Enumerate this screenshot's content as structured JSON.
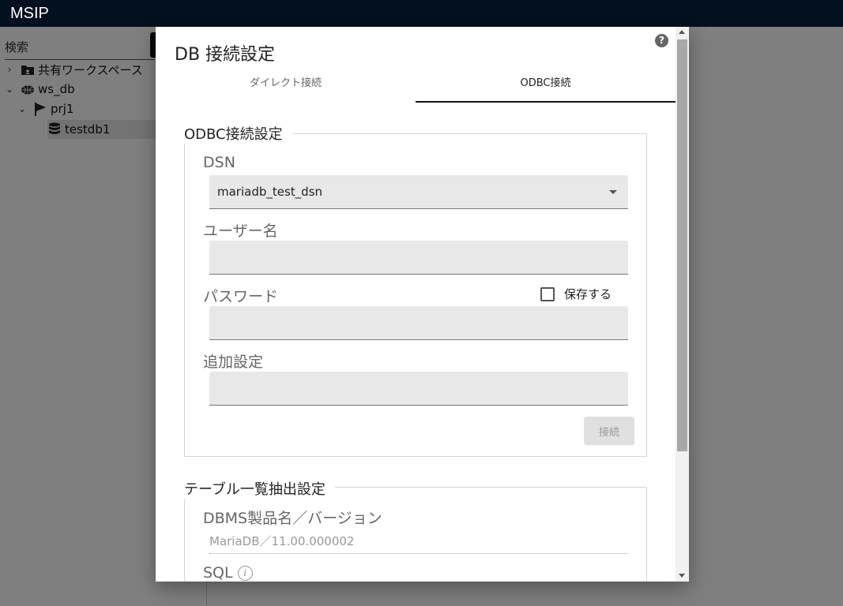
{
  "app": {
    "title": "MSIP"
  },
  "sidebar": {
    "search_placeholder": "検索",
    "tree": [
      {
        "label": "共有ワークスペース",
        "chevron": "›",
        "icon": "shared-folder-icon"
      },
      {
        "label": "ws_db",
        "chevron": "⌄",
        "icon": "globe-icon"
      },
      {
        "label": "prj1",
        "chevron": "⌄",
        "icon": "flag-icon"
      },
      {
        "label": "testdb1",
        "chevron": "",
        "icon": "database-icon"
      }
    ]
  },
  "dialog": {
    "title": "DB 接続設定",
    "help_icon": "?",
    "tabs": [
      {
        "label": "ダイレクト接続",
        "active": false
      },
      {
        "label": "ODBC接続",
        "active": true
      }
    ],
    "odbc_section": {
      "legend": "ODBC接続設定",
      "dsn_label": "DSN",
      "dsn_value": "mariadb_test_dsn",
      "username_label": "ユーザー名",
      "username_value": "",
      "password_label": "パスワード",
      "password_value": "",
      "save_label": "保存する",
      "save_checked": false,
      "extra_label": "追加設定",
      "extra_value": "",
      "connect_label": "接続"
    },
    "table_section": {
      "legend": "テーブル一覧抽出設定",
      "dbms_label": "DBMS製品名／バージョン",
      "dbms_value": "MariaDB／11.00.000002",
      "sql_label": "SQL",
      "info_icon": "i"
    }
  },
  "colors": {
    "header_bg": "#03101f",
    "overlay": "rgba(0,0,0,0.5)",
    "field_bg": "#e8e8e8"
  }
}
